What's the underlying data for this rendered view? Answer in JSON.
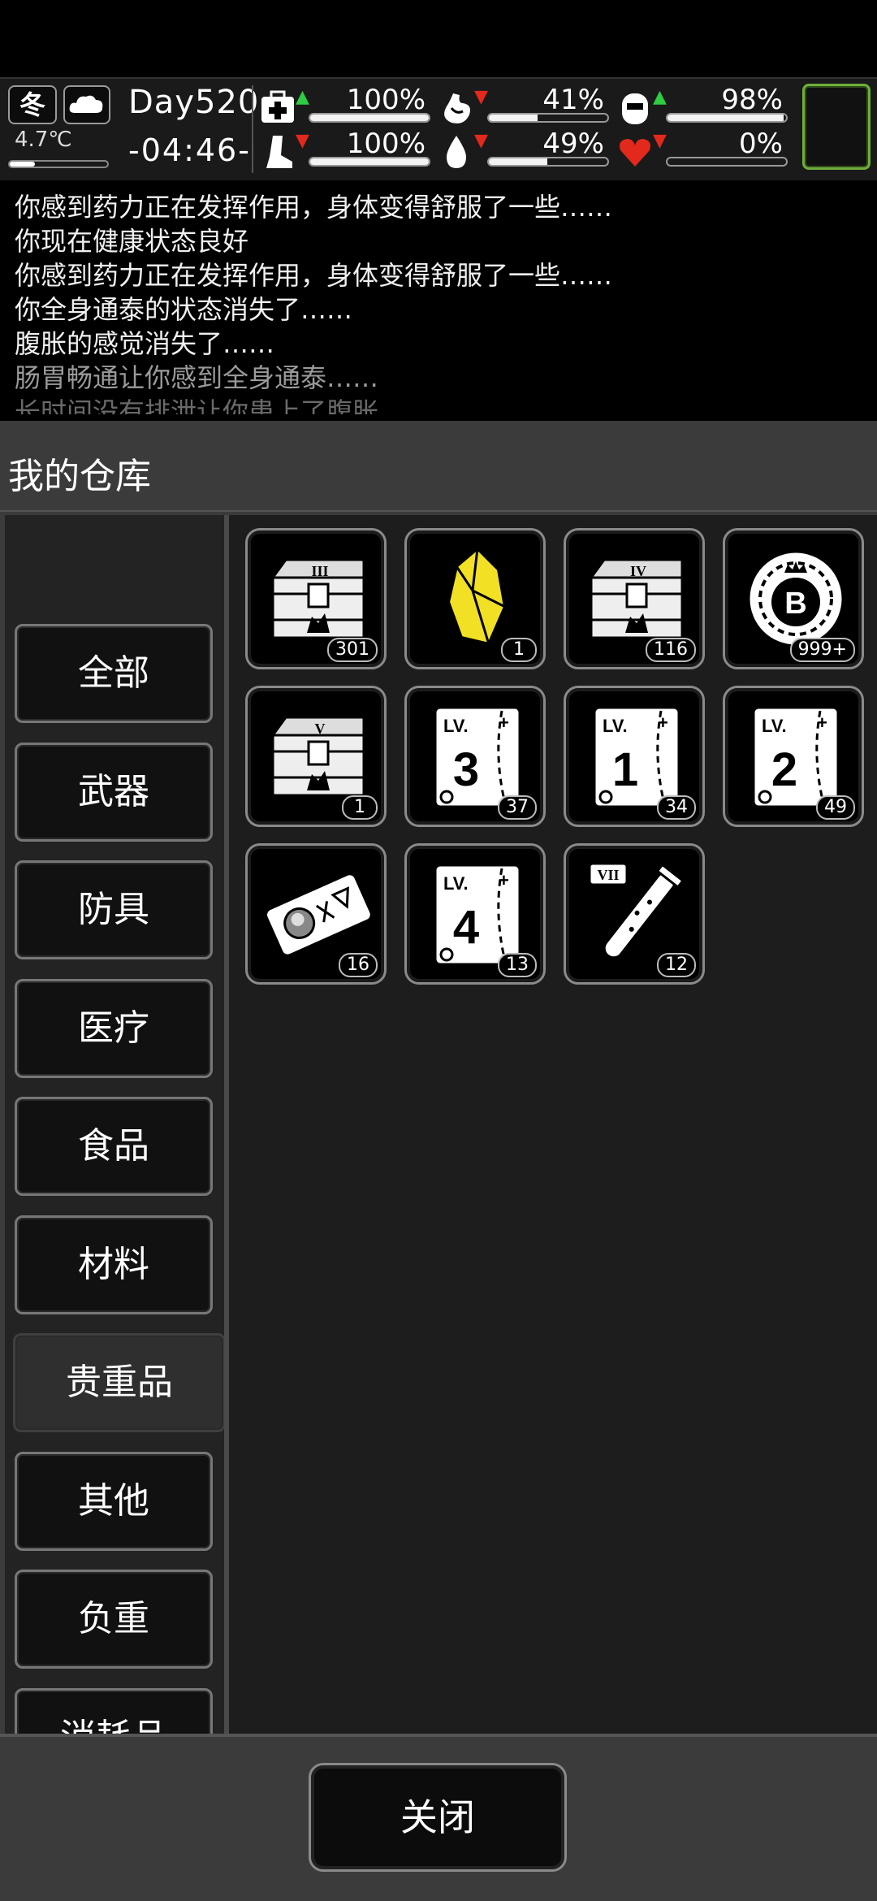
{
  "status": {
    "season": "冬",
    "temperature": "4.7℃",
    "temperature_level": 0.26,
    "day": "Day520",
    "time": "-04:46-",
    "stats": [
      {
        "name": "health",
        "icon": "medkit-icon",
        "trend": "up",
        "value": "100%",
        "level": 1.0
      },
      {
        "name": "stomach",
        "icon": "stomach-icon",
        "trend": "down",
        "value": "41%",
        "level": 0.41
      },
      {
        "name": "bladder",
        "icon": "bladder-icon",
        "trend": "up",
        "value": "98%",
        "level": 0.98
      },
      {
        "name": "stamina",
        "icon": "leg-icon",
        "trend": "down",
        "value": "100%",
        "level": 1.0
      },
      {
        "name": "water",
        "icon": "water-drop-icon",
        "trend": "down",
        "value": "49%",
        "level": 0.49
      },
      {
        "name": "mood",
        "icon": "heart-icon",
        "trend": "down",
        "value": "0%",
        "level": 0.0
      }
    ],
    "colors": {
      "up": "#2ecc40",
      "down": "#e3281c",
      "heart": "#e3281c",
      "frame": "#6fae3c"
    }
  },
  "log": [
    "你感到药力正在发挥作用，身体变得舒服了一些……",
    "你现在健康状态良好",
    "你感到药力正在发挥作用，身体变得舒服了一些……",
    "你全身通泰的状态消失了……",
    "腹胀的感觉消失了……",
    "肠胃畅通让你感到全身通泰……",
    "长时间没有排泄让你患上了腹胀"
  ],
  "panel": {
    "title": "我的仓库",
    "categories": [
      "全部",
      "武器",
      "防具",
      "医疗",
      "食品",
      "材料",
      "贵重品",
      "其他",
      "负重",
      "消耗品"
    ],
    "active_category": "贵重品",
    "items": [
      {
        "icon": "supply-crate-iii-icon",
        "count": "301"
      },
      {
        "icon": "gold-crystal-icon",
        "count": "1"
      },
      {
        "icon": "supply-crate-iv-icon",
        "count": "116"
      },
      {
        "icon": "bitcoin-chip-icon",
        "count": "999+"
      },
      {
        "icon": "supply-crate-v-icon",
        "count": "1"
      },
      {
        "icon": "skill-book-lv3-icon",
        "count": "37"
      },
      {
        "icon": "skill-book-lv1-icon",
        "count": "34"
      },
      {
        "icon": "skill-book-lv2-icon",
        "count": "49"
      },
      {
        "icon": "ticket-icon",
        "count": "16"
      },
      {
        "icon": "skill-book-lv4-icon",
        "count": "13"
      },
      {
        "icon": "test-tube-vii-icon",
        "count": "12"
      }
    ],
    "close_label": "关闭"
  }
}
